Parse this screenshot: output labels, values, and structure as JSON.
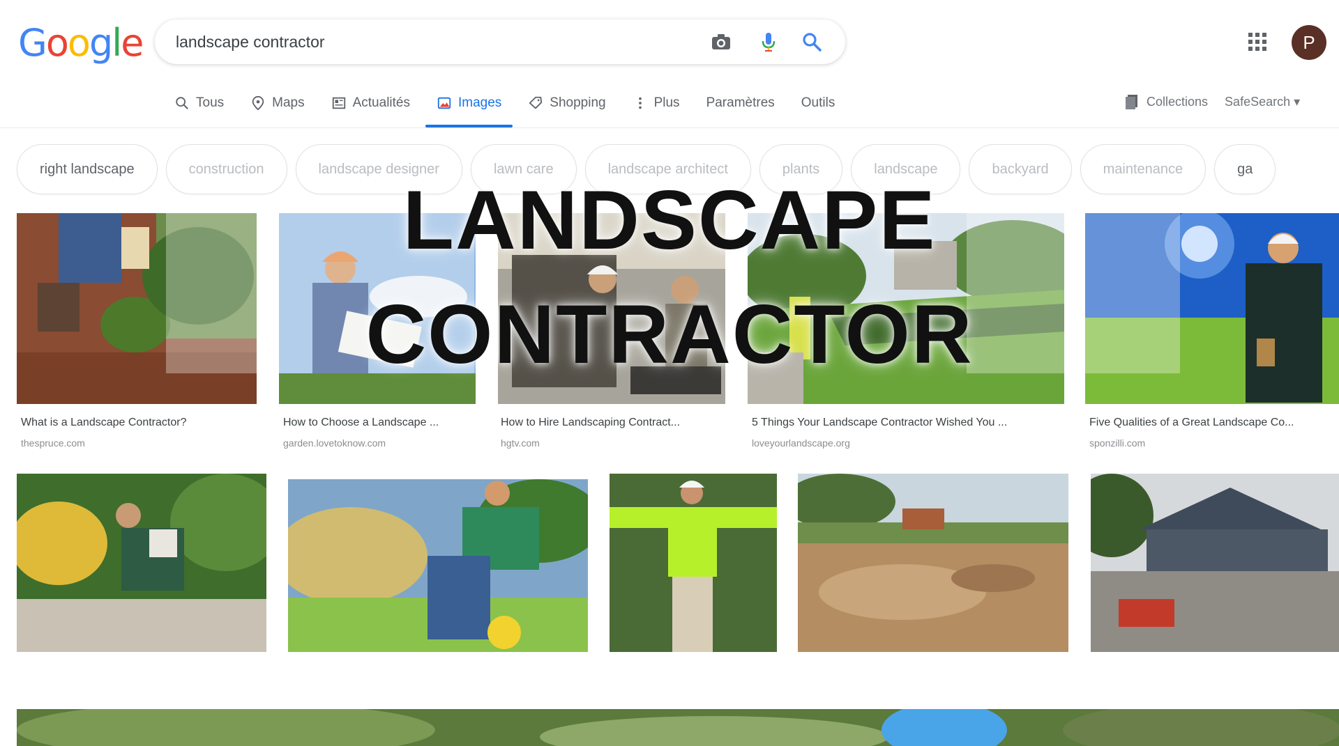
{
  "header": {
    "logo_letters": [
      "G",
      "o",
      "o",
      "g",
      "l",
      "e"
    ],
    "search_query": "landscape contractor",
    "avatar_letter": "P"
  },
  "tabs": [
    {
      "label": "Tous",
      "icon": "search-icon"
    },
    {
      "label": "Maps",
      "icon": "map-pin-icon"
    },
    {
      "label": "Actualités",
      "icon": "newspaper-icon"
    },
    {
      "label": "Images",
      "icon": "image-icon",
      "active": true
    },
    {
      "label": "Shopping",
      "icon": "tag-icon"
    },
    {
      "label": "Plus",
      "icon": "more-vert-icon"
    },
    {
      "label": "Paramètres"
    },
    {
      "label": "Outils"
    }
  ],
  "tools_right": {
    "collections": "Collections",
    "safesearch": "SafeSearch ▾"
  },
  "chips": [
    "right landscape",
    "construction",
    "landscape designer",
    "lawn care",
    "landscape architect",
    "plants",
    "landscape",
    "backyard",
    "maintenance",
    "ga"
  ],
  "overlay": {
    "line1": "LANDSCAPE",
    "line2": "CONTRACTOR"
  },
  "results_row1": [
    {
      "caption": "What is a Landscape Contractor?",
      "source": "thespruce.com"
    },
    {
      "caption": "How to Choose a Landscape ...",
      "source": "garden.lovetoknow.com"
    },
    {
      "caption": "How to Hire Landscaping Contract...",
      "source": "hgtv.com"
    },
    {
      "caption": "5 Things Your Landscape Contractor Wished You ...",
      "source": "loveyourlandscape.org"
    },
    {
      "caption": "Five Qualities of a Great Landscape Co...",
      "source": "sponzilli.com"
    }
  ],
  "colors": {
    "accent": "#1a73e8",
    "google_blue": "#4285f4",
    "google_red": "#ea4335",
    "google_yellow": "#fbbc05",
    "google_green": "#34a853"
  }
}
